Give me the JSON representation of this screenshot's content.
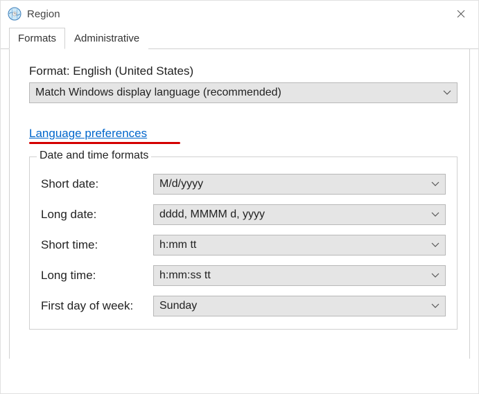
{
  "window": {
    "title": "Region"
  },
  "tabs": {
    "formats": "Formats",
    "administrative": "Administrative"
  },
  "format": {
    "label": "Format: English (United States)",
    "selected": "Match Windows display language (recommended)"
  },
  "link": {
    "language_preferences": "Language preferences"
  },
  "datetime": {
    "legend": "Date and time formats",
    "short_date_label": "Short date:",
    "short_date_value": "M/d/yyyy",
    "long_date_label": "Long date:",
    "long_date_value": "dddd, MMMM d, yyyy",
    "short_time_label": "Short time:",
    "short_time_value": "h:mm tt",
    "long_time_label": "Long time:",
    "long_time_value": "h:mm:ss tt",
    "first_day_label": "First day of week:",
    "first_day_value": "Sunday"
  }
}
